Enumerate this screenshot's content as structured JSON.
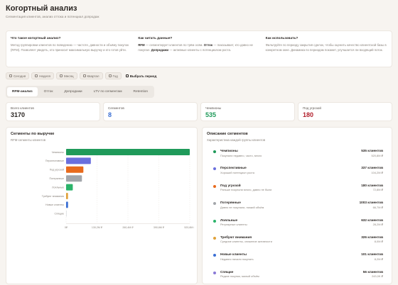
{
  "header": {
    "title": "Когортный анализ",
    "subtitle": "Сегментация клиентов, анализ оттока и потенциал допродаж"
  },
  "info": [
    {
      "heading": "Что такое когортный анализ?",
      "text": "Метод группировки клиентов по поведению — частоте, давности и объёму покупок (RFM). Позволяет увидеть, кто приносит максимальную выручку и кто готов уйти."
    },
    {
      "heading": "Как читать данные?",
      "text_a": "RFM",
      "text_b": " — сегментирует клиентов по трём осям. ",
      "text_c": "Отток",
      "text_d": " — показывает, кто давно не покупал. ",
      "text_e": "Допродажи",
      "text_f": " — активные клиенты с потенциалом роста."
    },
    {
      "heading": "Как использовать?",
      "text": "Фильтруйте по периоду закрытия сделок, чтобы оценить качество клиентской базы в конкретном окне. Динамика по периодам покажет, улучшается ли входящий поток."
    }
  ],
  "periods": [
    "Сегодня",
    "Неделя",
    "Месяц",
    "Квартал",
    "Год"
  ],
  "pick_period": "Выбрать период",
  "tabs": [
    "RFM-анализ",
    "Отток",
    "Допродажи",
    "LTV по сегментам",
    "Retention"
  ],
  "stats": [
    {
      "label": "Всего клиентов",
      "value": "3170",
      "color": "#2a2522"
    },
    {
      "label": "Сегментов",
      "value": "8",
      "color": "#3b6fd4"
    },
    {
      "label": "Чемпионы",
      "value": "535",
      "color": "#1f9a5a"
    },
    {
      "label": "Под угрозой",
      "value": "180",
      "color": "#b3222e"
    }
  ],
  "chart_card": {
    "title": "Сегменты по выручке",
    "subtitle": "RFM-сегменты клиентов"
  },
  "chart_data": {
    "type": "bar",
    "orientation": "horizontal",
    "categories": [
      "Чемпионы",
      "Перспективные",
      "Под угрозой",
      "Потерянные",
      "Лояльные",
      "Требуют внимания",
      "Новые клиенты",
      "Спящие"
    ],
    "values": [
      520.8,
      104.2,
      72.8,
      66.7,
      28.2,
      8.0,
      8.2,
      0.2
    ],
    "unit": "M ₽",
    "colors": [
      "#1f9a5a",
      "#6a6fdd",
      "#e86a1c",
      "#a3a6ab",
      "#2bb36a",
      "#e0a23a",
      "#3b6fd4",
      "#b8bcc2"
    ],
    "xticks": [
      "0₽",
      "130,2M ₽",
      "260,4M ₽",
      "390,6M ₽",
      "520,8M ₽"
    ],
    "xlim": [
      0,
      520.8
    ]
  },
  "desc_card": {
    "title": "Описание сегментов",
    "subtitle": "Характеристика каждой группы клиентов"
  },
  "segments": [
    {
      "name": "Чемпионы",
      "desc": "Покупали недавно, часто, много",
      "count": "535 клиентов",
      "rev": "520,8M ₽",
      "color": "#1f9a5a"
    },
    {
      "name": "Перспективные",
      "desc": "Хороший потенциал роста",
      "count": "337 клиентов",
      "rev": "104,2M ₽",
      "color": "#6a6fdd"
    },
    {
      "name": "Под угрозой",
      "desc": "Раньше покупали много, давно не были",
      "count": "180 клиентов",
      "rev": "72,8M ₽",
      "color": "#e86a1c"
    },
    {
      "name": "Потерянные",
      "desc": "Давно не покупали, низкий объём",
      "count": "1003 клиентов",
      "rev": "66,7M ₽",
      "color": "#a3a6ab"
    },
    {
      "name": "Лояльные",
      "desc": "Регулярные клиенты",
      "count": "632 клиентов",
      "rev": "28,2M ₽",
      "color": "#2bb36a"
    },
    {
      "name": "Требуют внимания",
      "desc": "Средние клиенты, снижение активности",
      "count": "326 клиентов",
      "rev": "8,0M ₽",
      "color": "#e0a23a"
    },
    {
      "name": "Новые клиенты",
      "desc": "Недавно начали покупать",
      "count": "101 клиентов",
      "rev": "8,2M ₽",
      "color": "#3b6fd4"
    },
    {
      "name": "Спящие",
      "desc": "Редкие покупки, малый объём",
      "count": "56 клиентов",
      "rev": "243,0K ₽",
      "color": "#8a7ad6"
    }
  ]
}
